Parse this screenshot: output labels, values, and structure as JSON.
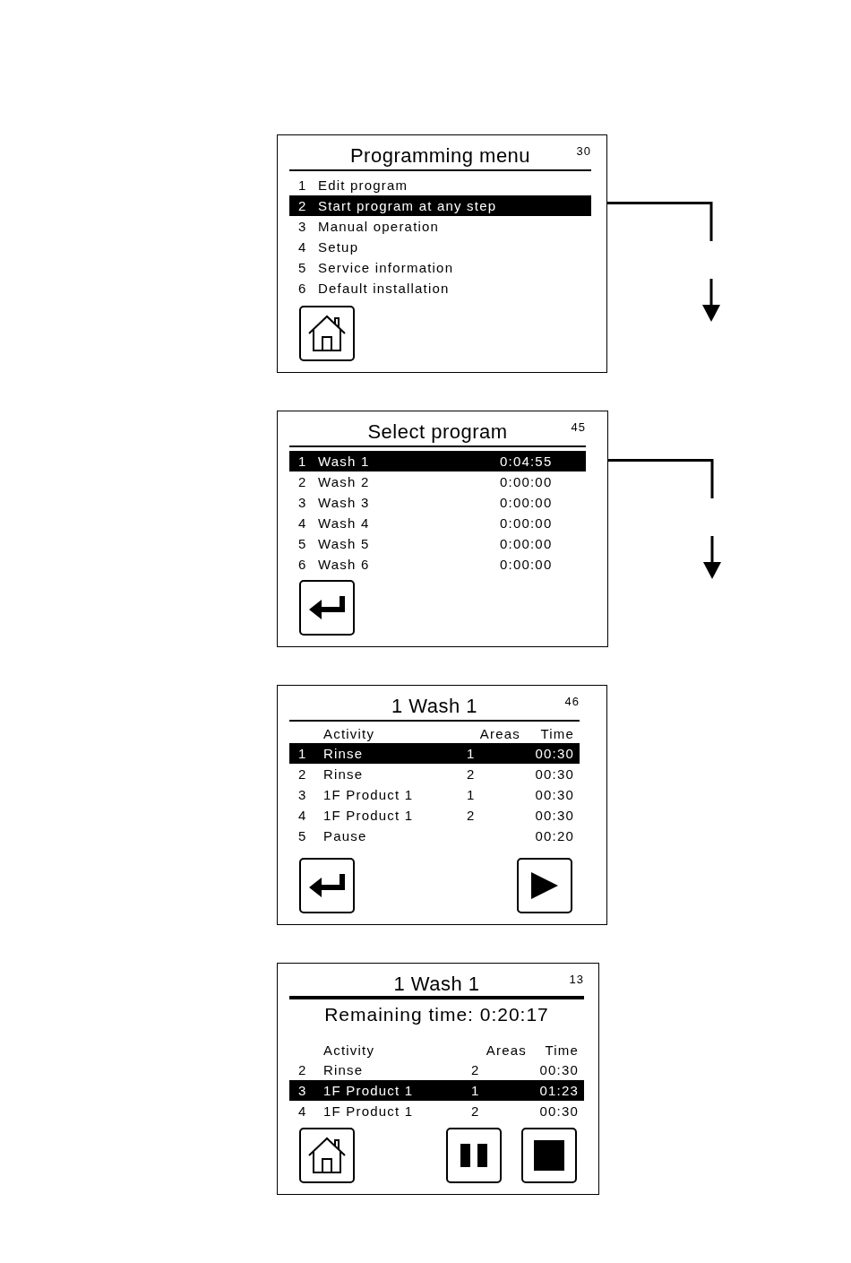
{
  "screens": [
    {
      "kind": "menu",
      "title": "Programming menu",
      "number": "30",
      "flow_arrow": true,
      "rows": [
        {
          "cells": [
            "1",
            "Edit program"
          ],
          "selected": false
        },
        {
          "cells": [
            "2",
            "Start program at any step"
          ],
          "selected": true
        },
        {
          "cells": [
            "3",
            "Manual operation"
          ],
          "selected": false
        },
        {
          "cells": [
            "4",
            "Setup"
          ],
          "selected": false
        },
        {
          "cells": [
            "5",
            "Service information"
          ],
          "selected": false
        },
        {
          "cells": [
            "6",
            "Default installation"
          ],
          "selected": false
        }
      ],
      "buttons": [
        {
          "kind": "home"
        }
      ]
    },
    {
      "kind": "programs",
      "title": "Select program",
      "number": "45",
      "flow_arrow": true,
      "rows": [
        {
          "cells": [
            "1",
            "Wash 1",
            "0:04:55"
          ],
          "selected": true
        },
        {
          "cells": [
            "2",
            "Wash 2",
            "0:00:00"
          ],
          "selected": false
        },
        {
          "cells": [
            "3",
            "Wash 3",
            "0:00:00"
          ],
          "selected": false
        },
        {
          "cells": [
            "4",
            "Wash 4",
            "0:00:00"
          ],
          "selected": false
        },
        {
          "cells": [
            "5",
            "Wash 5",
            "0:00:00"
          ],
          "selected": false
        },
        {
          "cells": [
            "6",
            "Wash 6",
            "0:00:00"
          ],
          "selected": false
        }
      ],
      "buttons": [
        {
          "kind": "enter"
        }
      ]
    },
    {
      "kind": "activities",
      "title": "1 Wash 1",
      "number": "46",
      "flow_arrow": false,
      "columns": [
        "",
        "Activity",
        "Areas",
        "Time"
      ],
      "rows": [
        {
          "cells": [
            "1",
            "Rinse",
            "1",
            "00:30"
          ],
          "selected": true
        },
        {
          "cells": [
            "2",
            "Rinse",
            "2",
            "00:30"
          ],
          "selected": false
        },
        {
          "cells": [
            "3",
            "1F Product 1",
            "1",
            "00:30"
          ],
          "selected": false
        },
        {
          "cells": [
            "4",
            "1F Product 1",
            "2",
            "00:30"
          ],
          "selected": false
        },
        {
          "cells": [
            "5",
            "Pause",
            "",
            "00:20"
          ],
          "selected": false
        }
      ],
      "buttons": [
        {
          "kind": "enter"
        },
        {
          "kind": "play"
        }
      ]
    },
    {
      "kind": "running",
      "title": "1 Wash 1",
      "number": "13",
      "flow_arrow": false,
      "subtitle": "Remaining time: 0:20:17",
      "columns": [
        "",
        "Activity",
        "Areas",
        "Time"
      ],
      "rows": [
        {
          "cells": [
            "2",
            "Rinse",
            "2",
            "00:30"
          ],
          "selected": false
        },
        {
          "cells": [
            "3",
            "1F Product 1",
            "1",
            "01:23"
          ],
          "selected": true
        },
        {
          "cells": [
            "4",
            "1F Product 1",
            "2",
            "00:30"
          ],
          "selected": false
        }
      ],
      "buttons": [
        {
          "kind": "home"
        },
        {
          "kind": "pause"
        },
        {
          "kind": "stop"
        }
      ]
    }
  ]
}
